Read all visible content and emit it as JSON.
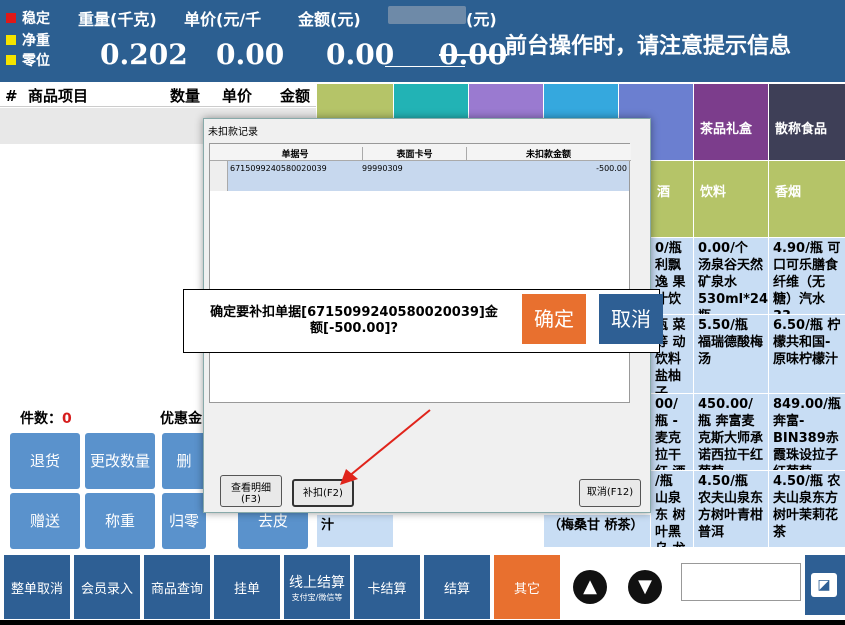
{
  "status": {
    "stable": "稳定",
    "net": "净重",
    "zero": "零位"
  },
  "headers": {
    "weight": "重量(千克)",
    "unit_price": "单价(元/千",
    "amount": "金额(元)",
    "amount2": "(元)"
  },
  "values": {
    "weight": "0.202",
    "unit_price": "0.00",
    "amount": "0.00",
    "amount2": "0.00"
  },
  "marquee": "前台操作时，请注意提示信息",
  "table": {
    "hash": "#",
    "item": "商品项目",
    "qty": "数量",
    "price": "单价",
    "amount": "金额"
  },
  "summary": {
    "count_label": "件数：",
    "count": "0",
    "discount_label": "优惠金"
  },
  "left_buttons": {
    "return": "退货",
    "change_qty": "更改数量",
    "delete": "删",
    "gift": "赠送",
    "weigh": "称重",
    "zero": "归零",
    "clear": "去皮"
  },
  "categories": {
    "gift_tea": "茶品礼盒",
    "bulk_food": "散称食品",
    "liquor": "酒",
    "drink": "饮料",
    "tobacco": "香烟"
  },
  "products": {
    "p1": "0/瓶 利飘逸 果汁饮",
    "p2": "0.00/个 汤泉谷天然矿泉水 530ml*24瓶",
    "p3": "4.90/瓶 可口可乐膳食纤维（无糖）汽水33",
    "p4": "瓶 菜等 动饮料 盐柚子",
    "p5": "5.50/瓶 福瑞德酸梅汤",
    "p6": "6.50/瓶 柠檬共和国-原味柠檬汁",
    "p7": "00/瓶 -麦克 拉干红 酒",
    "p8": "450.00/瓶 奔富麦克斯大师承诺西拉干红葡萄",
    "p9": "849.00/瓶 奔富-BIN389赤霞珠设拉子红葡萄",
    "p10": "/瓶 山泉东 树叶黑乌 龙茶",
    "p11": "4.50/瓶 农夫山泉东方树叶青柑普洱",
    "p12": "4.50/瓶 农夫山泉东方树叶茉莉花茶",
    "p13": "（梅桑甘 桥茶）",
    "p14": "汁"
  },
  "footer": {
    "cancel_all": "整单取消",
    "member": "会员录入",
    "query": "商品查询",
    "hold": "挂单",
    "online": "线上结算",
    "online_sub": "支付宝/微信等",
    "card": "卡结算",
    "checkout": "结算",
    "other": "其它"
  },
  "dialog": {
    "title": "未扣款记录",
    "columns": [
      "单据号",
      "表面卡号",
      "未扣款金额"
    ],
    "rows": [
      [
        "6715099240580020039",
        "99990309",
        "-500.00"
      ]
    ],
    "detail_btn": "查看明细",
    "detail_key": "(F3)",
    "deduct_btn": "补扣(F2)",
    "cancel_btn": "取消(F12)"
  },
  "confirm": {
    "message": "确定要补扣单据[6715099240580020039]金额[-500.00]?",
    "ok": "确定",
    "cancel": "取消"
  },
  "colors": {
    "topbar": "#2c5f91",
    "ok": "#e8702f",
    "cancel": "#2e5f94",
    "arrow": "#e0241b"
  }
}
